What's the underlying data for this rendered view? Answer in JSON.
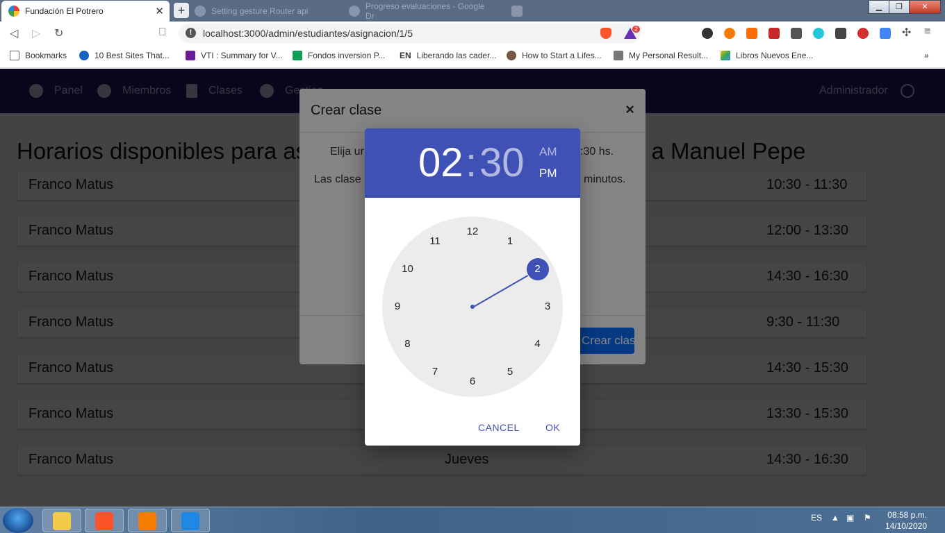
{
  "browser": {
    "active_tab_title": "Fundación El Potrero",
    "inactive_tabs": [
      "Setting gesture Router api",
      "Progreso evaluaciones - Google Dr"
    ],
    "url": "localhost:3000/admin/estudiantes/asignacion/1/5",
    "brave_badge": "2",
    "bookmarks": [
      "Bookmarks",
      "10 Best Sites That...",
      "VTI : Summary for V...",
      "Fondos inversion P...",
      "Liberando las cader...",
      "How to Start a Lifes...",
      "My Personal Result...",
      "Libros Nuevos Ene..."
    ],
    "bookmark_en": "EN",
    "more": "»"
  },
  "app_nav": {
    "items": [
      "Panel",
      "Miembros",
      "Clases",
      "Gestion"
    ],
    "user": "Administrador"
  },
  "page": {
    "title": "Horarios disponibles para asignar clase de programacion web a Manuel Pepe",
    "rows": [
      {
        "name": "Franco Matus",
        "day": "",
        "time": "10:30 - 11:30"
      },
      {
        "name": "Franco Matus",
        "day": "",
        "time": "12:00 - 13:30"
      },
      {
        "name": "Franco Matus",
        "day": "",
        "time": "14:30 - 16:30"
      },
      {
        "name": "Franco Matus",
        "day": "",
        "time": "9:30 - 11:30"
      },
      {
        "name": "Franco Matus",
        "day": "",
        "time": "14:30 - 15:30"
      },
      {
        "name": "Franco Matus",
        "day": "",
        "time": "13:30 - 15:30"
      },
      {
        "name": "Franco Matus",
        "day": "Jueves",
        "time": "14:30 - 16:30"
      }
    ]
  },
  "modal": {
    "title": "Crear clase",
    "close": "×",
    "text1_left": "Elija ur",
    "text1_right": ":30 hs.",
    "text2_left": "Las clase",
    "text2_right": "minutos.",
    "button": "Crear clase"
  },
  "time_picker": {
    "hour": "02",
    "colon": ":",
    "minute": "30",
    "am": "AM",
    "pm": "PM",
    "selected_hour": 2,
    "numbers": [
      "12",
      "1",
      "2",
      "3",
      "4",
      "5",
      "6",
      "7",
      "8",
      "9",
      "10",
      "11"
    ],
    "cancel": "CANCEL",
    "ok": "OK"
  },
  "taskbar": {
    "lang": "ES",
    "time": "08:58 p.m.",
    "date": "14/10/2020"
  }
}
